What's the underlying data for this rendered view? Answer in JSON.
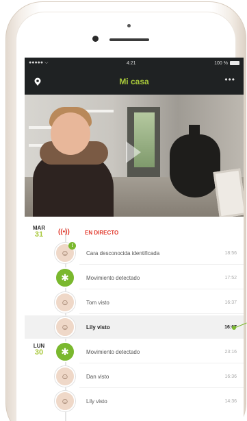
{
  "status_bar": {
    "carrier": "●●●●● ⌵",
    "time": "4:21",
    "battery_text": "100 %"
  },
  "nav": {
    "title": "Mi casa",
    "menu": "•••"
  },
  "timeline": {
    "days": [
      {
        "name": "MAR",
        "num": "31"
      },
      {
        "name": "LUN",
        "num": "30"
      }
    ],
    "live_label": "EN DIRECTO",
    "events": [
      {
        "text": "Cara desconocida identificada",
        "time": "18:56",
        "type": "face",
        "badge": "!"
      },
      {
        "text": "Movimiento detectado",
        "time": "17:52",
        "type": "motion"
      },
      {
        "text": "Tom visto",
        "time": "16:37",
        "type": "face"
      },
      {
        "text": "Lily visto",
        "time": "16:07",
        "type": "face",
        "highlight": true
      },
      {
        "text": "Movimiento detectado",
        "time": "23:16",
        "type": "motion"
      },
      {
        "text": "Dan visto",
        "time": "16:36",
        "type": "face"
      },
      {
        "text": "Lily visto",
        "time": "14:36",
        "type": "face"
      }
    ]
  },
  "colors": {
    "accent": "#a8c83a",
    "motion": "#7ab82e",
    "live": "#e23b2e",
    "bar": "#1f2223"
  }
}
